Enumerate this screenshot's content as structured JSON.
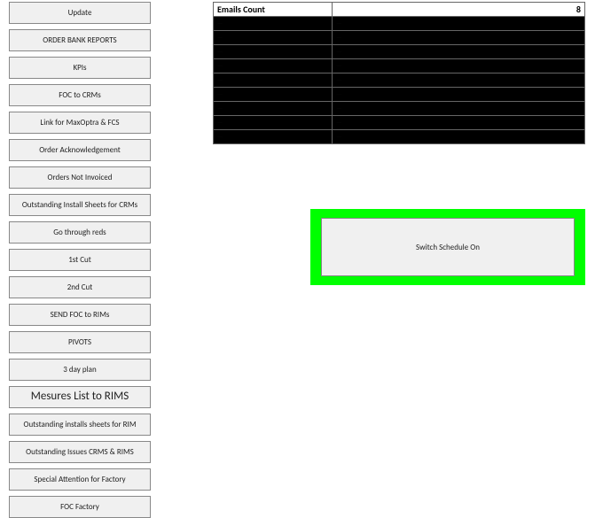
{
  "sidebar": {
    "buttons": [
      {
        "id": "update",
        "label": "Update"
      },
      {
        "id": "order-bank-reports",
        "label": "ORDER BANK REPORTS"
      },
      {
        "id": "kpis",
        "label": "KPIs"
      },
      {
        "id": "foc-to-crms",
        "label": "FOC to CRMs"
      },
      {
        "id": "link-maxoptra-fcs",
        "label": "Link for MaxOptra & FCS"
      },
      {
        "id": "order-ack",
        "label": "Order Acknowledgement"
      },
      {
        "id": "orders-not-invoiced",
        "label": "Orders Not Invoiced"
      },
      {
        "id": "outstanding-install-crms",
        "label": "Outstanding Install Sheets for CRMs"
      },
      {
        "id": "go-through-reds",
        "label": "Go through reds"
      },
      {
        "id": "first-cut",
        "label": "1st Cut"
      },
      {
        "id": "second-cut",
        "label": "2nd Cut"
      },
      {
        "id": "send-foc-rims",
        "label": "SEND FOC to RIMs"
      },
      {
        "id": "pivots",
        "label": "PIVOTS"
      },
      {
        "id": "three-day-plan",
        "label": "3 day plan"
      },
      {
        "id": "measures-list-rims",
        "label": "Mesures List to RIMS",
        "big": true
      },
      {
        "id": "outstanding-install-rim",
        "label": "Outstanding installs sheets for RIM"
      },
      {
        "id": "outstanding-issues",
        "label": "Outstanding Issues CRMS & RIMS"
      },
      {
        "id": "special-attention-factory",
        "label": "Special Attention for Factory"
      },
      {
        "id": "foc-factory",
        "label": "FOC Factory"
      }
    ]
  },
  "emails": {
    "header_label": "Emails Count",
    "count": "8",
    "rows": [
      {
        "name": "—",
        "email": "—"
      },
      {
        "name": "—",
        "email": "—"
      },
      {
        "name": "—",
        "email": "—"
      },
      {
        "name": "—",
        "email": "—"
      },
      {
        "name": "—",
        "email": "—"
      },
      {
        "name": "—",
        "email": "—"
      },
      {
        "name": "—",
        "email": "—"
      },
      {
        "name": "—",
        "email": "—"
      },
      {
        "name": "—",
        "email": "—"
      }
    ]
  },
  "switch": {
    "label": "Switch Schedule On",
    "frame_color": "#00ff00"
  }
}
